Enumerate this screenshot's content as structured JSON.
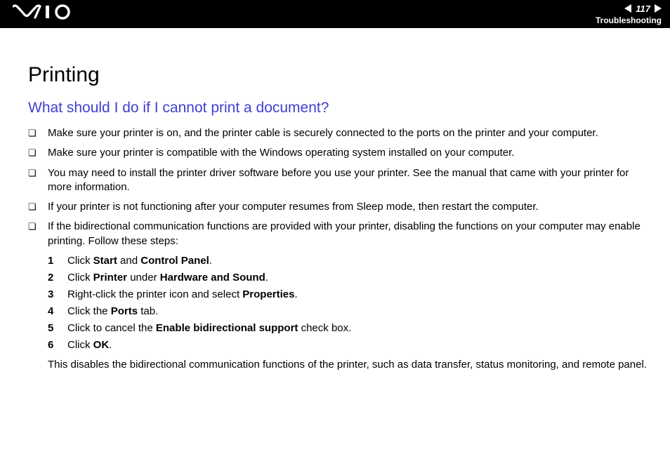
{
  "header": {
    "logo_text": "VAIO",
    "page_number": "117",
    "section": "Troubleshooting"
  },
  "page": {
    "title": "Printing",
    "subtitle": "What should I do if I cannot print a document?"
  },
  "bullets": [
    {
      "text": "Make sure your printer is on, and the printer cable is securely connected to the ports on the printer and your computer."
    },
    {
      "text": "Make sure your printer is compatible with the Windows operating system installed on your computer."
    },
    {
      "text": "You may need to install the printer driver software before you use your printer. See the manual that came with your printer for more information."
    },
    {
      "text": "If your printer is not functioning after your computer resumes from Sleep mode, then restart the computer."
    },
    {
      "text": "If the bidirectional communication functions are provided with your printer, disabling the functions on your computer may enable printing. Follow these steps:"
    }
  ],
  "steps": [
    {
      "num": "1",
      "pre": "Click ",
      "b1": "Start",
      "mid": " and ",
      "b2": "Control Panel",
      "post": "."
    },
    {
      "num": "2",
      "pre": "Click ",
      "b1": "Printer",
      "mid": " under ",
      "b2": "Hardware and Sound",
      "post": "."
    },
    {
      "num": "3",
      "pre": "Right-click the printer icon and select ",
      "b1": "Properties",
      "mid": "",
      "b2": "",
      "post": "."
    },
    {
      "num": "4",
      "pre": "Click the ",
      "b1": "Ports",
      "mid": "",
      "b2": "",
      "post": " tab."
    },
    {
      "num": "5",
      "pre": "Click to cancel the ",
      "b1": "Enable bidirectional support",
      "mid": "",
      "b2": "",
      "post": " check box."
    },
    {
      "num": "6",
      "pre": "Click ",
      "b1": "OK",
      "mid": "",
      "b2": "",
      "post": "."
    }
  ],
  "followup": "This disables the bidirectional communication functions of the printer, such as data transfer, status monitoring, and remote panel."
}
